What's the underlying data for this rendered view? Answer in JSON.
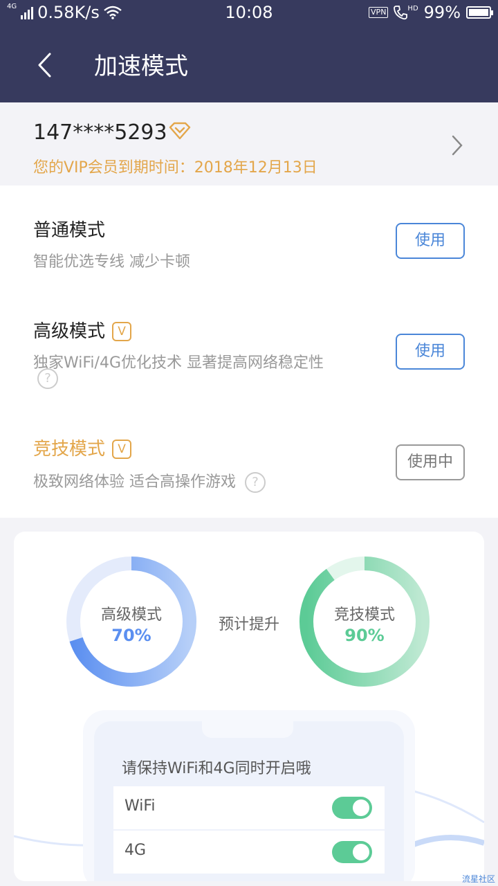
{
  "status_bar": {
    "network_type": "4G",
    "speed": "0.58K/s",
    "time": "10:08",
    "vpn": "VPN",
    "hd": "HD",
    "battery": "99%"
  },
  "nav": {
    "title": "加速模式",
    "background_color": "#373a5e"
  },
  "account": {
    "phone": "147****5293",
    "expiry": "您的VIP会员到期时间：2018年12月13日",
    "accent_color": "#e3a64a"
  },
  "modes": [
    {
      "title": "普通模式",
      "desc": "智能优选专线 减少卡顿",
      "button": "使用"
    },
    {
      "title": "高级模式",
      "badge": "V",
      "desc": "独家WiFi/4G优化技术 显著提高网络稳定性",
      "help": "?",
      "button": "使用"
    },
    {
      "title": "竞技模式",
      "badge": "V",
      "desc": "极致网络体验 适合高操作游戏",
      "help": "?",
      "button": "使用中"
    }
  ],
  "stats": {
    "predict_label": "预计提升",
    "advanced": {
      "label": "高级模式",
      "percent": "70%",
      "value": 0.7,
      "color": "#5b8ff0"
    },
    "competitive": {
      "label": "竞技模式",
      "percent": "90%",
      "value": 0.9,
      "color": "#5ccb96"
    }
  },
  "phone_card": {
    "hint": "请保持WiFi和4G同时开启哦",
    "toggles": [
      {
        "label": "WiFi",
        "on": true
      },
      {
        "label": "4G",
        "on": true
      }
    ]
  },
  "watermark": "流星社区"
}
